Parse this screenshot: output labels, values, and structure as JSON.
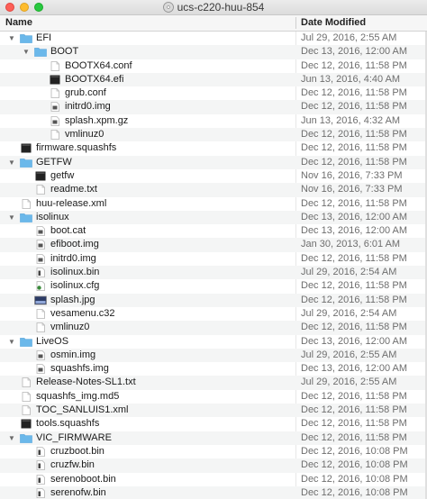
{
  "window": {
    "title": "ucs-c220-huu-854"
  },
  "columns": {
    "name": "Name",
    "date": "Date Modified"
  },
  "rows": [
    {
      "name": "EFI",
      "date": "Jul 29, 2016, 2:55 AM",
      "level": 0,
      "kind": "folder",
      "disclosure": "open"
    },
    {
      "name": "BOOT",
      "date": "Dec 13, 2016, 12:00 AM",
      "level": 1,
      "kind": "folder",
      "disclosure": "open"
    },
    {
      "name": "BOOTX64.conf",
      "date": "Dec 12, 2016, 11:58 PM",
      "level": 2,
      "kind": "doc"
    },
    {
      "name": "BOOTX64.efi",
      "date": "Jun 13, 2016, 4:40 AM",
      "level": 2,
      "kind": "exec"
    },
    {
      "name": "grub.conf",
      "date": "Dec 12, 2016, 11:58 PM",
      "level": 2,
      "kind": "doc"
    },
    {
      "name": "initrd0.img",
      "date": "Dec 12, 2016, 11:58 PM",
      "level": 2,
      "kind": "img"
    },
    {
      "name": "splash.xpm.gz",
      "date": "Jun 13, 2016, 4:32 AM",
      "level": 2,
      "kind": "img"
    },
    {
      "name": "vmlinuz0",
      "date": "Dec 12, 2016, 11:58 PM",
      "level": 2,
      "kind": "doc"
    },
    {
      "name": "firmware.squashfs",
      "date": "Dec 12, 2016, 11:58 PM",
      "level": 0,
      "kind": "exec"
    },
    {
      "name": "GETFW",
      "date": "Dec 12, 2016, 11:58 PM",
      "level": 0,
      "kind": "folder",
      "disclosure": "open"
    },
    {
      "name": "getfw",
      "date": "Nov 16, 2016, 7:33 PM",
      "level": 1,
      "kind": "exec"
    },
    {
      "name": "readme.txt",
      "date": "Nov 16, 2016, 7:33 PM",
      "level": 1,
      "kind": "doc"
    },
    {
      "name": "huu-release.xml",
      "date": "Dec 12, 2016, 11:58 PM",
      "level": 0,
      "kind": "doc"
    },
    {
      "name": "isolinux",
      "date": "Dec 13, 2016, 12:00 AM",
      "level": 0,
      "kind": "folder",
      "disclosure": "open"
    },
    {
      "name": "boot.cat",
      "date": "Dec 13, 2016, 12:00 AM",
      "level": 1,
      "kind": "img"
    },
    {
      "name": "efiboot.img",
      "date": "Jan 30, 2013, 6:01 AM",
      "level": 1,
      "kind": "img"
    },
    {
      "name": "initrd0.img",
      "date": "Dec 12, 2016, 11:58 PM",
      "level": 1,
      "kind": "img"
    },
    {
      "name": "isolinux.bin",
      "date": "Jul 29, 2016, 2:54 AM",
      "level": 1,
      "kind": "bin"
    },
    {
      "name": "isolinux.cfg",
      "date": "Dec 12, 2016, 11:58 PM",
      "level": 1,
      "kind": "cfg"
    },
    {
      "name": "splash.jpg",
      "date": "Dec 12, 2016, 11:58 PM",
      "level": 1,
      "kind": "jpg"
    },
    {
      "name": "vesamenu.c32",
      "date": "Jul 29, 2016, 2:54 AM",
      "level": 1,
      "kind": "doc"
    },
    {
      "name": "vmlinuz0",
      "date": "Dec 12, 2016, 11:58 PM",
      "level": 1,
      "kind": "doc"
    },
    {
      "name": "LiveOS",
      "date": "Dec 13, 2016, 12:00 AM",
      "level": 0,
      "kind": "folder",
      "disclosure": "open"
    },
    {
      "name": "osmin.img",
      "date": "Jul 29, 2016, 2:55 AM",
      "level": 1,
      "kind": "img"
    },
    {
      "name": "squashfs.img",
      "date": "Dec 13, 2016, 12:00 AM",
      "level": 1,
      "kind": "img"
    },
    {
      "name": "Release-Notes-SL1.txt",
      "date": "Jul 29, 2016, 2:55 AM",
      "level": 0,
      "kind": "doc"
    },
    {
      "name": "squashfs_img.md5",
      "date": "Dec 12, 2016, 11:58 PM",
      "level": 0,
      "kind": "doc"
    },
    {
      "name": "TOC_SANLUIS1.xml",
      "date": "Dec 12, 2016, 11:58 PM",
      "level": 0,
      "kind": "doc"
    },
    {
      "name": "tools.squashfs",
      "date": "Dec 12, 2016, 11:58 PM",
      "level": 0,
      "kind": "exec"
    },
    {
      "name": "VIC_FIRMWARE",
      "date": "Dec 12, 2016, 11:58 PM",
      "level": 0,
      "kind": "folder",
      "disclosure": "open"
    },
    {
      "name": "cruzboot.bin",
      "date": "Dec 12, 2016, 10:08 PM",
      "level": 1,
      "kind": "bin"
    },
    {
      "name": "cruzfw.bin",
      "date": "Dec 12, 2016, 10:08 PM",
      "level": 1,
      "kind": "bin"
    },
    {
      "name": "serenoboot.bin",
      "date": "Dec 12, 2016, 10:08 PM",
      "level": 1,
      "kind": "bin"
    },
    {
      "name": "serenofw.bin",
      "date": "Dec 12, 2016, 10:08 PM",
      "level": 1,
      "kind": "bin"
    }
  ],
  "colors": {
    "folder": "#6bb8ea",
    "folder_tab": "#5aa6db",
    "exec": "#222222",
    "doc_border": "#b5b5b5",
    "stripe": "#f4f5f5"
  }
}
